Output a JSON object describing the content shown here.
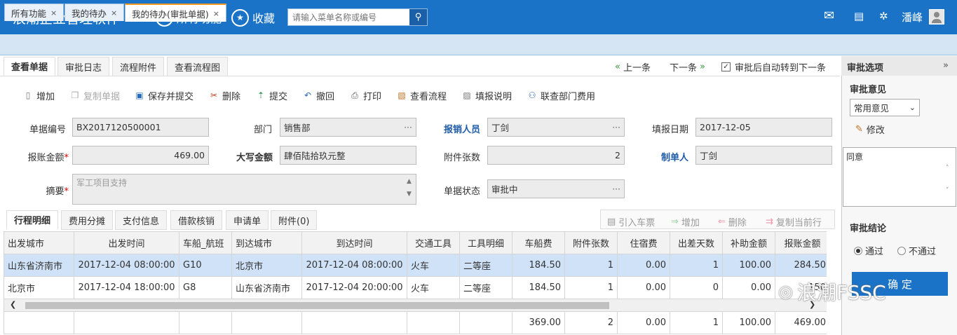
{
  "app": {
    "title": "浪潮企业管理软件",
    "all_functions": "所有功能",
    "favorites": "收藏",
    "search_placeholder": "请输入菜单名称或编号",
    "user": "潘峰"
  },
  "open_tabs": [
    {
      "label": "所有功能",
      "close": "×"
    },
    {
      "label": "我的待办",
      "close": "×"
    },
    {
      "label": "我的待办(审批单据)",
      "close": "×"
    }
  ],
  "sub_tabs": [
    "查看单据",
    "审批日志",
    "流程附件",
    "查看流程图"
  ],
  "nav": {
    "prev": "上一条",
    "next": "下一条",
    "auto_next": "审批后自动转到下一条"
  },
  "toolbar": [
    "增加",
    "复制单据",
    "保存并提交",
    "删除",
    "提交",
    "撤回",
    "打印",
    "查看流程",
    "填报说明",
    "联查部门费用"
  ],
  "form": {
    "doc_no_label": "单据编号",
    "doc_no": "BX2017120500001",
    "dept_label": "部门",
    "dept": "销售部",
    "claimant_label": "报销人员",
    "claimant": "丁剑",
    "fill_date_label": "填报日期",
    "fill_date": "2017-12-05",
    "amount_label": "报账金额",
    "amount": "469.00",
    "amount_cn_label": "大写金额",
    "amount_cn": "肆佰陆拾玖元整",
    "attach_label": "附件张数",
    "attach": "2",
    "maker_label": "制单人",
    "maker": "丁剑",
    "summary_label": "摘要",
    "summary": "军工项目支持",
    "status_label": "单据状态",
    "status": "审批中",
    "required_mark": "*",
    "dots": "···"
  },
  "grid_tabs": [
    "行程明细",
    "费用分摊",
    "支付信息",
    "借款核销",
    "申请单",
    "附件(0)"
  ],
  "grid_toolbar": [
    "引入车票",
    "增加",
    "删除",
    "复制当前行"
  ],
  "grid": {
    "columns": [
      "出发城市",
      "出发时间",
      "车船_航班",
      "到达城市",
      "到达时间",
      "交通工具",
      "工具明细",
      "车船费",
      "附件张数",
      "住宿费",
      "出差天数",
      "补助金额",
      "报账金额"
    ],
    "rows": [
      [
        "山东省济南市",
        "2017-12-04 08:00:00",
        "G10",
        "北京市",
        "2017-12-04 08:00:00",
        "火车",
        "二等座",
        "184.50",
        "1",
        "0.00",
        "1",
        "100.00",
        "284.50"
      ],
      [
        "北京市",
        "2017-12-04 18:00:00",
        "G8",
        "山东省济南市",
        "2017-12-04 20:00:00",
        "火车",
        "二等座",
        "184.50",
        "1",
        "0.00",
        "0",
        "0.00",
        "150"
      ]
    ],
    "totals": [
      "369.00",
      "2",
      "0.00",
      "1",
      "100.00",
      "469.00"
    ]
  },
  "right_panel": {
    "title": "审批选项",
    "opinion_title": "审批意见",
    "common_opinion": "常用意见",
    "edit": "修改",
    "opinion_text": "同意",
    "conclusion_title": "审批结论",
    "pass": "通过",
    "fail": "不通过",
    "confirm": "确 定"
  },
  "watermark": "浪潮FSSC"
}
